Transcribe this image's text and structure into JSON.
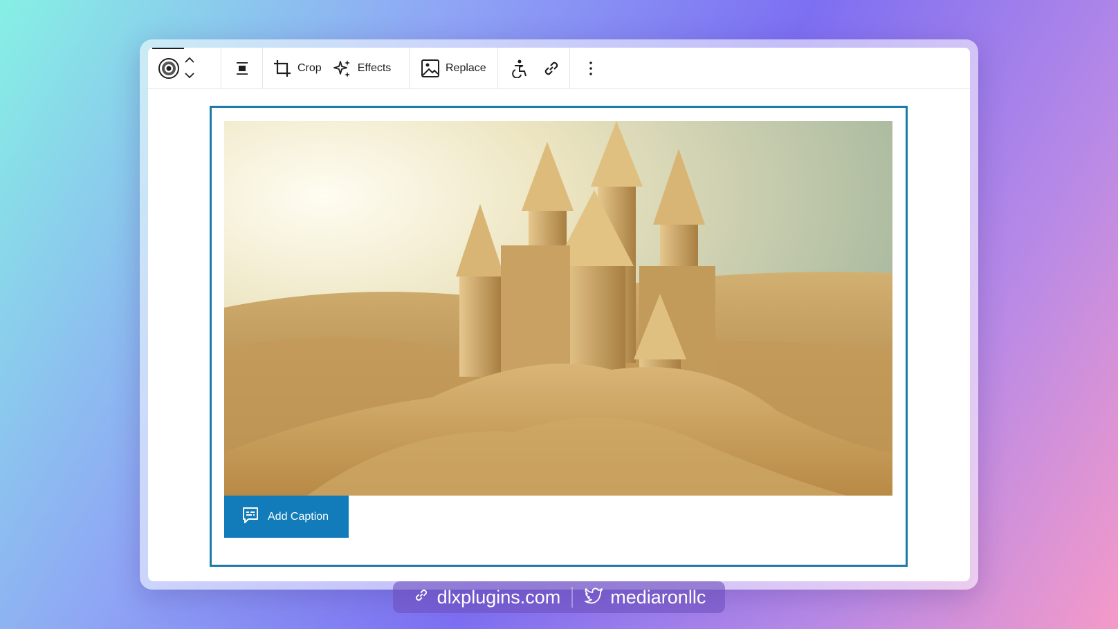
{
  "toolbar": {
    "block_icon": "block-logo-icon",
    "move_up_icon": "chevron-up-icon",
    "move_down_icon": "chevron-down-icon",
    "align_icon": "align-center-icon",
    "crop_label": "Crop",
    "effects_label": "Effects",
    "replace_label": "Replace",
    "accessibility_icon": "accessibility-icon",
    "link_icon": "link-icon",
    "more_icon": "more-vertical-icon"
  },
  "image_block": {
    "border_color": "#1a7aaa",
    "image_description_icon": "sandcastle-image",
    "caption_button_label": "Add Caption",
    "caption_button_color": "#117cb9"
  },
  "footer": {
    "website": "dlxplugins.com",
    "twitter": "mediaronllc"
  }
}
